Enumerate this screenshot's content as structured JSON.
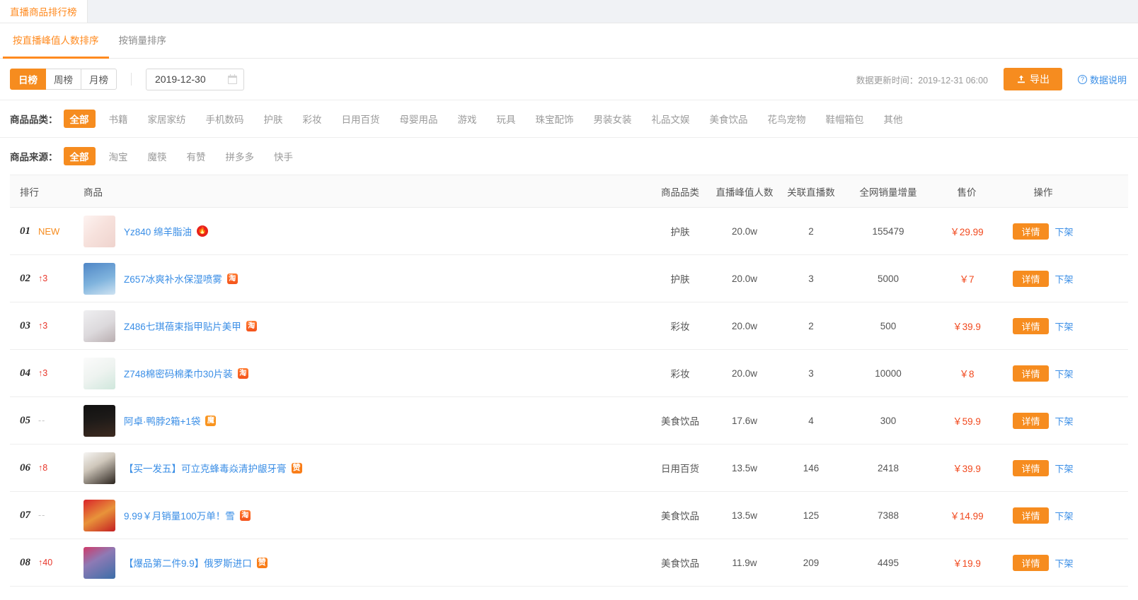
{
  "window_tab": {
    "label": "直播商品排行榜"
  },
  "sort_tabs": [
    {
      "label": "按直播峰值人数排序",
      "active": true
    },
    {
      "label": "按销量排序",
      "active": false
    }
  ],
  "toolbar": {
    "period_buttons": [
      {
        "label": "日榜",
        "active": true
      },
      {
        "label": "周榜",
        "active": false
      },
      {
        "label": "月榜",
        "active": false
      }
    ],
    "date_value": "2019-12-30",
    "calendar_icon": "calendar-icon",
    "updated_text": "数据更新时间：2019-12-31 06:00",
    "export_label": "导出",
    "export_icon": "upload-icon",
    "help_label": "数据说明",
    "help_icon": "question-circle-icon",
    "accent_color": "#f68c1f",
    "link_color": "#3a8ee6"
  },
  "filters": {
    "category": {
      "label": "商品品类：",
      "options": [
        "全部",
        "书籍",
        "家居家纺",
        "手机数码",
        "护肤",
        "彩妆",
        "日用百货",
        "母婴用品",
        "游戏",
        "玩具",
        "珠宝配饰",
        "男装女装",
        "礼品文娱",
        "美食饮品",
        "花鸟宠物",
        "鞋帽箱包",
        "其他"
      ],
      "selected": "全部"
    },
    "source": {
      "label": "商品来源：",
      "options": [
        "全部",
        "淘宝",
        "魔筷",
        "有赞",
        "拼多多",
        "快手"
      ],
      "selected": "全部"
    }
  },
  "table": {
    "columns": [
      "排行",
      "商品",
      "商品品类",
      "直播峰值人数",
      "关联直播数",
      "全网销量增量",
      "售价",
      "操作"
    ],
    "detail_label": "详情",
    "offshelf_label": "下架",
    "rows": [
      {
        "rank": "01",
        "trend": "NEW",
        "trend_type": "new",
        "name": "Yz840 绵羊脂油",
        "badge": "hot-badge",
        "badge_glyph": "🔥",
        "thumb": "skincare-cream-thumb",
        "category": "护肤",
        "peak": "20.0w",
        "lives": "2",
        "sales": "155479",
        "price": "￥29.99"
      },
      {
        "rank": "02",
        "trend": "↑3",
        "trend_type": "up",
        "name": "Z657冰爽补水保湿喷雾",
        "badge": "taobao-badge",
        "badge_glyph": "淘",
        "thumb": "spray-bottle-thumb",
        "category": "护肤",
        "peak": "20.0w",
        "lives": "3",
        "sales": "5000",
        "price": "￥7"
      },
      {
        "rank": "03",
        "trend": "↑3",
        "trend_type": "up",
        "name": "Z486七琪蓓束指甲贴片美甲",
        "badge": "taobao-badge",
        "badge_glyph": "淘",
        "thumb": "nail-art-thumb",
        "category": "彩妆",
        "peak": "20.0w",
        "lives": "2",
        "sales": "500",
        "price": "￥39.9"
      },
      {
        "rank": "04",
        "trend": "↑3",
        "trend_type": "up",
        "name": "Z748棉密码棉柔巾30片装",
        "badge": "taobao-badge",
        "badge_glyph": "淘",
        "thumb": "cotton-towel-thumb",
        "category": "彩妆",
        "peak": "20.0w",
        "lives": "3",
        "sales": "10000",
        "price": "￥8"
      },
      {
        "rank": "05",
        "trend": "--",
        "trend_type": "flat",
        "name": "阿卓·鸭脖2箱+1袋",
        "badge": "mokuai-badge",
        "badge_glyph": "魔",
        "thumb": "duck-neck-snack-thumb",
        "category": "美食饮品",
        "peak": "17.6w",
        "lives": "4",
        "sales": "300",
        "price": "￥59.9"
      },
      {
        "rank": "06",
        "trend": "↑8",
        "trend_type": "up",
        "name": "【买一发五】可立克蜂毒焱清护龈牙膏",
        "badge": "youzan-badge",
        "badge_glyph": "赞",
        "thumb": "toothpaste-thumb",
        "category": "日用百货",
        "peak": "13.5w",
        "lives": "146",
        "sales": "2418",
        "price": "￥39.9"
      },
      {
        "rank": "07",
        "trend": "--",
        "trend_type": "flat",
        "name": "9.99￥月销量100万单！雪",
        "badge": "taobao-badge",
        "badge_glyph": "淘",
        "thumb": "snack-package-thumb",
        "category": "美食饮品",
        "peak": "13.5w",
        "lives": "125",
        "sales": "7388",
        "price": "￥14.99"
      },
      {
        "rank": "08",
        "trend": "↑40",
        "trend_type": "up",
        "name": "【爆品第二件9.9】俄罗斯进口",
        "badge": "youzan-badge",
        "badge_glyph": "赞",
        "thumb": "candy-mix-thumb",
        "category": "美食饮品",
        "peak": "11.9w",
        "lives": "209",
        "sales": "4495",
        "price": "￥19.9"
      }
    ]
  }
}
